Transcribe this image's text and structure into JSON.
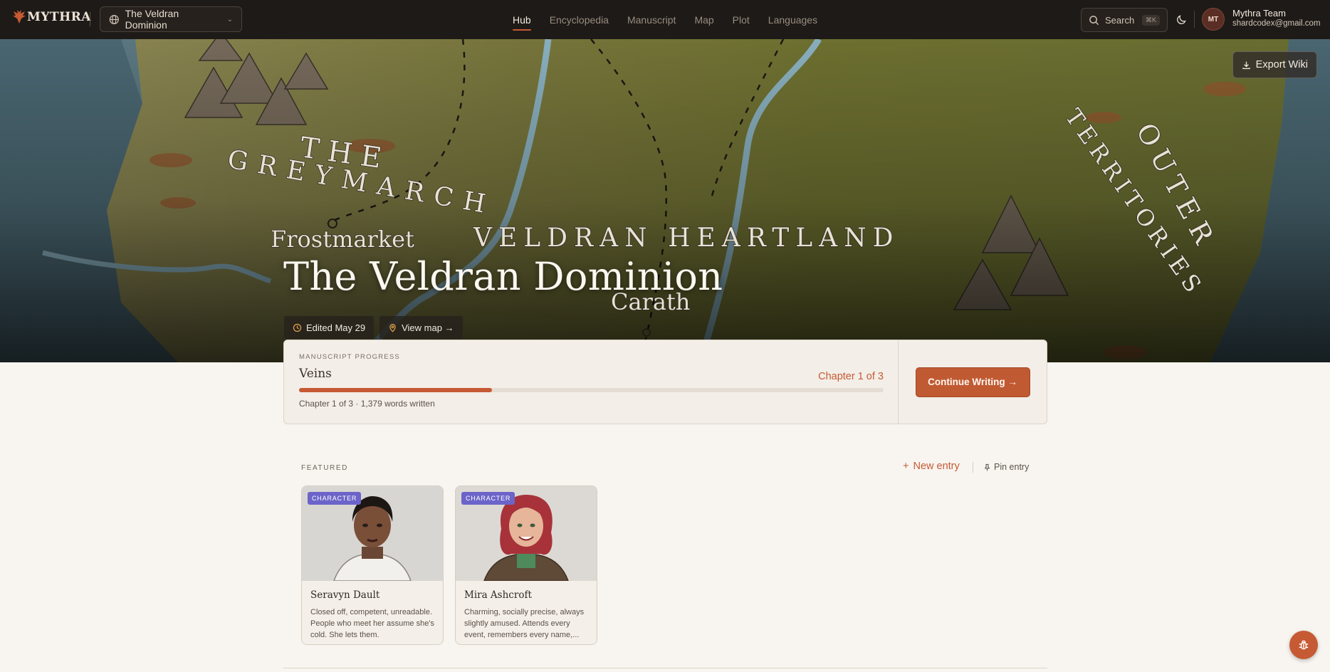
{
  "app": {
    "logo_text": "MYTHRA"
  },
  "world_selector": {
    "label": "The Veldran Dominion"
  },
  "nav_tabs": [
    {
      "label": "Hub",
      "active": true
    },
    {
      "label": "Encyclopedia"
    },
    {
      "label": "Manuscript"
    },
    {
      "label": "Map"
    },
    {
      "label": "Plot"
    },
    {
      "label": "Languages"
    }
  ],
  "search": {
    "label": "Search",
    "shortcut": "⌘K"
  },
  "user": {
    "initials": "MT",
    "name": "Mythra Team",
    "email": "shardcodex@gmail.com"
  },
  "hero": {
    "title": "The Veldran Dominion",
    "export_label": "Export Wiki",
    "edited_label": "Edited May 29",
    "view_map_label": "View map →",
    "map_labels": {
      "the": "THE",
      "greymarch": "GREYMARCH",
      "frostmarket": "Frostmarket",
      "heartland": "VELDRAN HEARTLAND",
      "carath": "Carath",
      "outer": "OUTER",
      "territories": "TERRITORIES"
    }
  },
  "manuscript": {
    "section_label": "MANUSCRIPT PROGRESS",
    "title": "Veins",
    "chapter_label": "Chapter 1 of 3",
    "progress": 0.33,
    "meta": "Chapter 1 of 3 · 1,379 words written",
    "continue_label": "Continue Writing →"
  },
  "featured": {
    "section_label": "FEATURED",
    "new_entry_label": "New entry",
    "pin_entry_label": "Pin entry",
    "cards": [
      {
        "badge": "CHARACTER",
        "name": "Seravyn Dault",
        "desc": "Closed off, competent, unreadable. People who meet her assume she's cold. She lets them."
      },
      {
        "badge": "CHARACTER",
        "name": "Mira Ashcroft",
        "desc": "Charming, socially precise, always slightly amused. Attends every event, remembers every name,..."
      }
    ]
  },
  "colors": {
    "accent": "#c65a34",
    "nav_bg": "#1e1a17",
    "badge": "#6c64c9",
    "page_bg": "#f8f5f0"
  }
}
